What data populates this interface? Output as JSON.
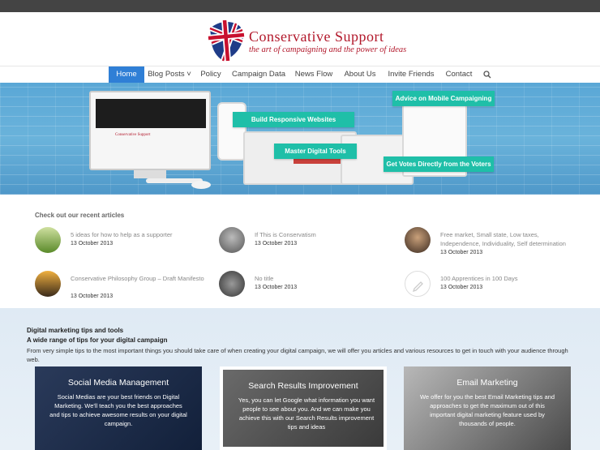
{
  "site": {
    "title": "Conservative Support",
    "tagline": "the art of campaigning and the power of ideas"
  },
  "nav": {
    "items": [
      {
        "label": "Home",
        "active": true
      },
      {
        "label": "Blog Posts ˅",
        "active": false
      },
      {
        "label": "Policy",
        "active": false
      },
      {
        "label": "Campaign Data",
        "active": false
      },
      {
        "label": "News Flow",
        "active": false
      },
      {
        "label": "About Us",
        "active": false
      },
      {
        "label": "Invite Friends",
        "active": false
      },
      {
        "label": "Contact",
        "active": false
      }
    ],
    "search_icon": "search-icon"
  },
  "hero": {
    "callouts": [
      "Advice on Mobile Campaigning",
      "Build Responsive Websites",
      "Master Digital Tools",
      "Get Votes Directly from the Voters"
    ],
    "mock_site_text": "Conservative Support"
  },
  "articles": {
    "heading": "Check out our recent articles",
    "items": [
      {
        "title": "5 ideas for how to help as a supporter",
        "date": "13 October 2013"
      },
      {
        "title": "If This is Conservatism",
        "date": "13 October 2013"
      },
      {
        "title": "Free market, Small state, Low taxes, Independence, Individuality, Self determination",
        "date": "13 October 2013"
      },
      {
        "title": "Conservative Philosophy Group – Draft Manifesto",
        "date": "13 October 2013"
      },
      {
        "title": "No title",
        "date": "13 October 2013"
      },
      {
        "title": "100 Apprentices in 100 Days",
        "date": "13 October 2013"
      }
    ]
  },
  "tips": {
    "heading": "Digital marketing tips and tools",
    "subheading": "A wide range of tips for your digital campaign",
    "intro": "From very simple tips to the most important things you should take care of when creating your digital campaign, we will offer you articles and various resources to get in touch with your audience through web.",
    "cards": [
      {
        "title": "Social Media Management",
        "text": "Social Medias are your best friends on Digital Marketing. We'll teach you the best approaches and tips to achieve awesome results on your digital campaign."
      },
      {
        "title": "Search Results Improvement",
        "text": "Yes, you can let Google what information you want people to see about you. And we can make you achieve this with our Search Results improvement tips and ideas"
      },
      {
        "title": "Email Marketing",
        "text": "We offer for you the best Email Marketing tips and approaches to get the maximum out of this important digital marketing feature used by thousands of people."
      }
    ]
  },
  "colors": {
    "brand_red": "#b2182b",
    "nav_active": "#2f7fd6",
    "callout": "#1fbfa8"
  }
}
